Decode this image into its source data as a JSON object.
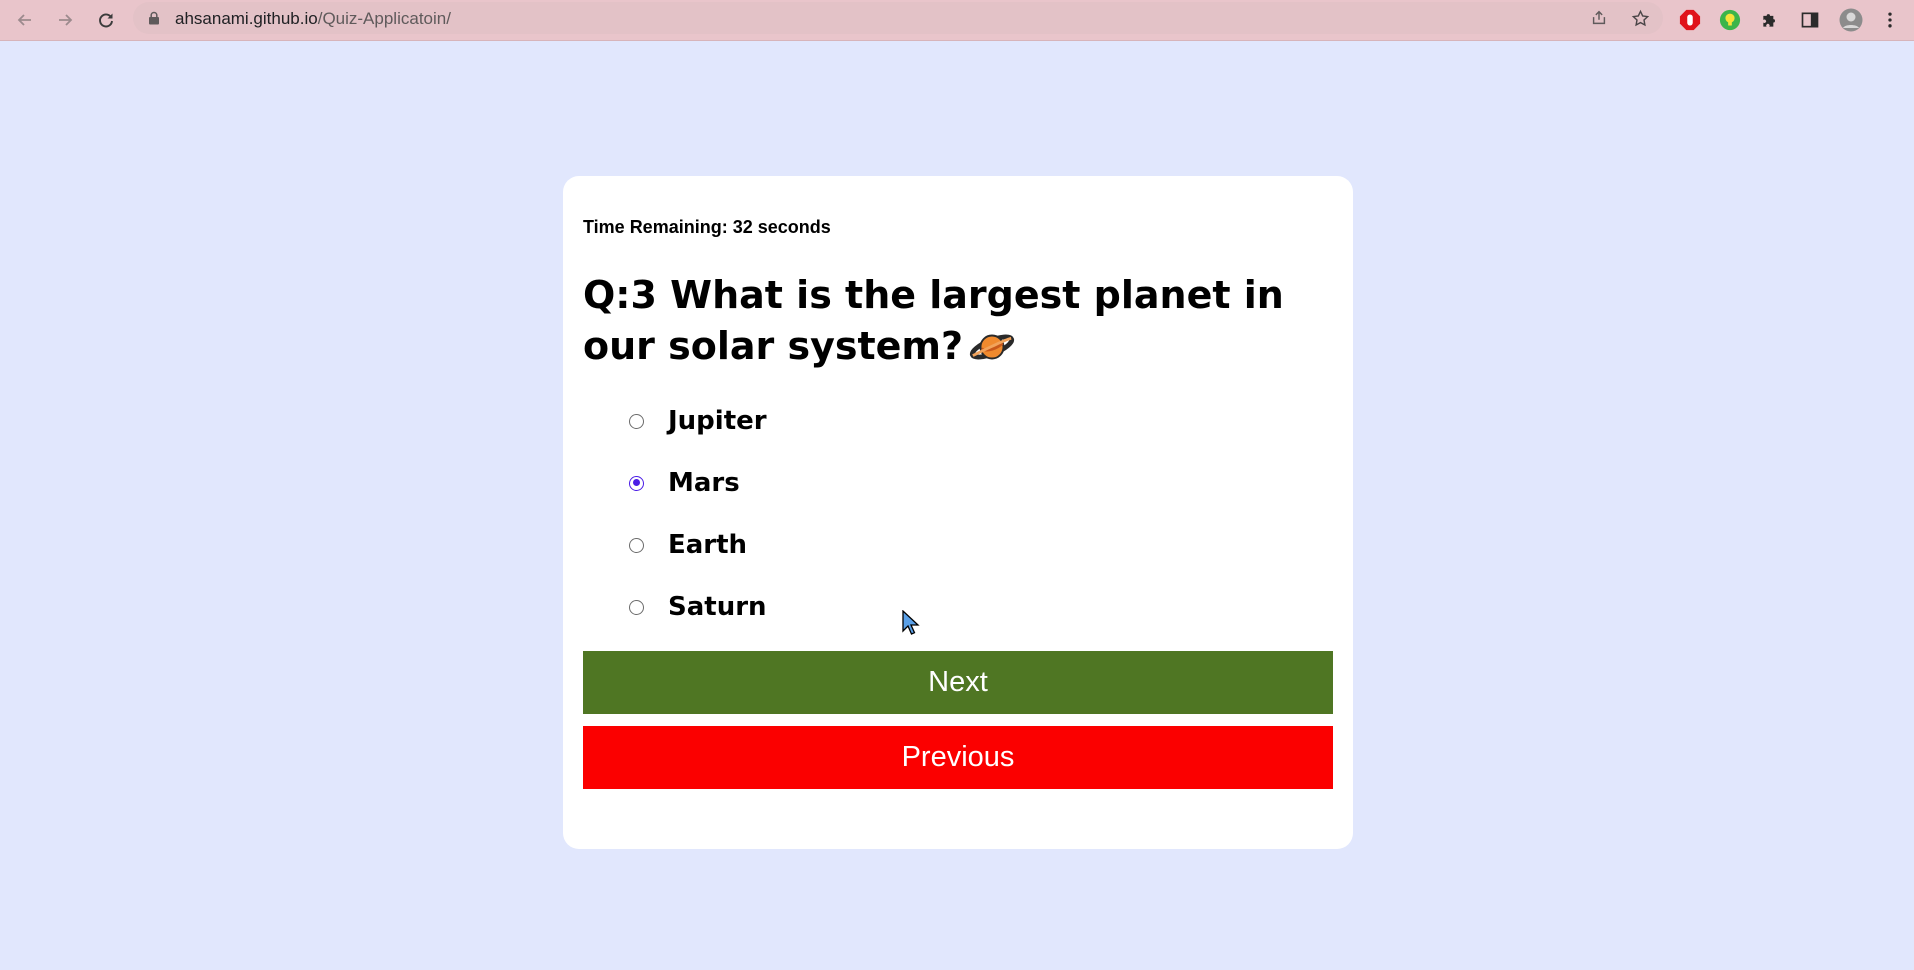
{
  "browser": {
    "url_host": "ahsanami.github.io",
    "url_path": "/Quiz-Applicatoin/",
    "toolbar_color": "#e9c5cb"
  },
  "quiz": {
    "timer_text": "Time Remaining: 32 seconds",
    "question_text": "Q:3 What is the largest planet in our solar system?",
    "question_icon": "ringed-planet-icon",
    "options": [
      {
        "label": "Jupiter",
        "checked": false
      },
      {
        "label": "Mars",
        "checked": true
      },
      {
        "label": "Earth",
        "checked": false
      },
      {
        "label": "Saturn",
        "checked": false
      }
    ],
    "next_label": "Next",
    "previous_label": "Previous",
    "colors": {
      "background": "#e1e7fd",
      "next_button": "#4f7623",
      "previous_button": "#fb0000",
      "radio_checked": "#4b1de6"
    }
  }
}
